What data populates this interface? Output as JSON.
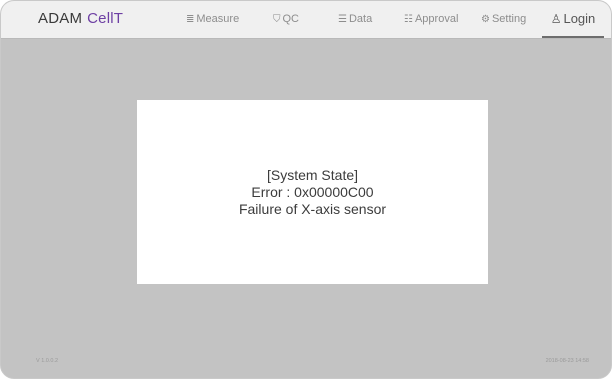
{
  "brand": {
    "name": "ADAM",
    "highlight": "CellT"
  },
  "nav": {
    "measure": {
      "icon": "≣",
      "label": "Measure"
    },
    "qc": {
      "icon": "⛉",
      "label": "QC"
    },
    "data": {
      "icon": "☰",
      "label": "Data"
    },
    "approval": {
      "icon": "☷",
      "label": "Approval"
    },
    "setting": {
      "icon": "⚙",
      "label": "Setting"
    },
    "login": {
      "icon": "♙",
      "label": "Login"
    }
  },
  "dialog": {
    "title": "[System State]",
    "error": "Error : 0x00000C00",
    "message": "Failure of X-axis sensor"
  },
  "footer": {
    "version": "V 1.0.0.2",
    "timestamp": "2018-08-23 14:58"
  },
  "colors": {
    "accent": "#6d3fa3",
    "background": "#c3c3c3",
    "navbar": "#f0f0f0"
  }
}
